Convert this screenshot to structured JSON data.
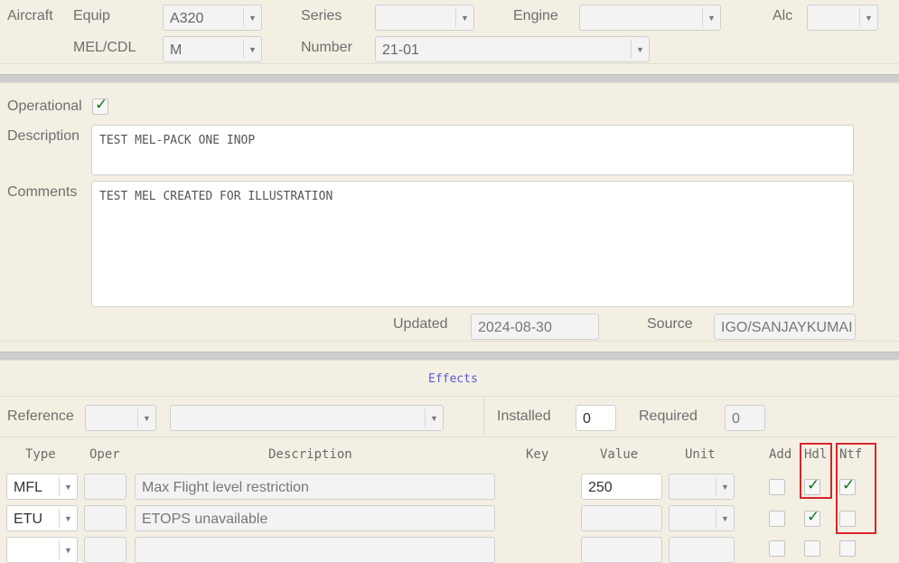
{
  "header": {
    "aircraft_label": "Aircraft",
    "equip_label": "Equip",
    "equip_value": "A320",
    "series_label": "Series",
    "series_value": "",
    "engine_label": "Engine",
    "engine_value": "",
    "alc_label": "Alc",
    "alc_value": "",
    "melcdl_label": "MEL/CDL",
    "melcdl_value": "M",
    "number_label": "Number",
    "number_value": "21-01"
  },
  "details": {
    "operational_label": "Operational",
    "operational_checked": true,
    "description_label": "Description",
    "description_value": "TEST MEL-PACK ONE INOP",
    "comments_label": "Comments",
    "comments_value": "TEST MEL CREATED FOR ILLUSTRATION",
    "updated_label": "Updated",
    "updated_value": "2024-08-30",
    "source_label": "Source",
    "source_value": "IGO/SANJAYKUMAI"
  },
  "effects": {
    "title": "Effects",
    "reference_label": "Reference",
    "reference_value": "",
    "reference_detail_value": "",
    "installed_label": "Installed",
    "installed_value": "0",
    "required_label": "Required",
    "required_value": "0",
    "columns": {
      "type": "Type",
      "oper": "Oper",
      "description": "Description",
      "key": "Key",
      "value": "Value",
      "unit": "Unit",
      "add": "Add",
      "hdl": "Hdl",
      "ntf": "Ntf"
    },
    "rows": [
      {
        "type": "MFL",
        "oper": "",
        "description": "Max Flight level restriction",
        "value": "250",
        "unit": "",
        "add": false,
        "hdl": true,
        "ntf": true
      },
      {
        "type": "ETU",
        "oper": "",
        "description": "ETOPS unavailable",
        "value": "",
        "unit": "",
        "add": false,
        "hdl": true,
        "ntf": false
      }
    ]
  },
  "icons": {
    "dropdown": "chevron-down-icon",
    "check": "checkmark-icon"
  },
  "colors": {
    "background": "#f4efe3",
    "highlight": "#d6262b",
    "check": "#0a7a1a",
    "effects_title": "#5b5bd6"
  }
}
